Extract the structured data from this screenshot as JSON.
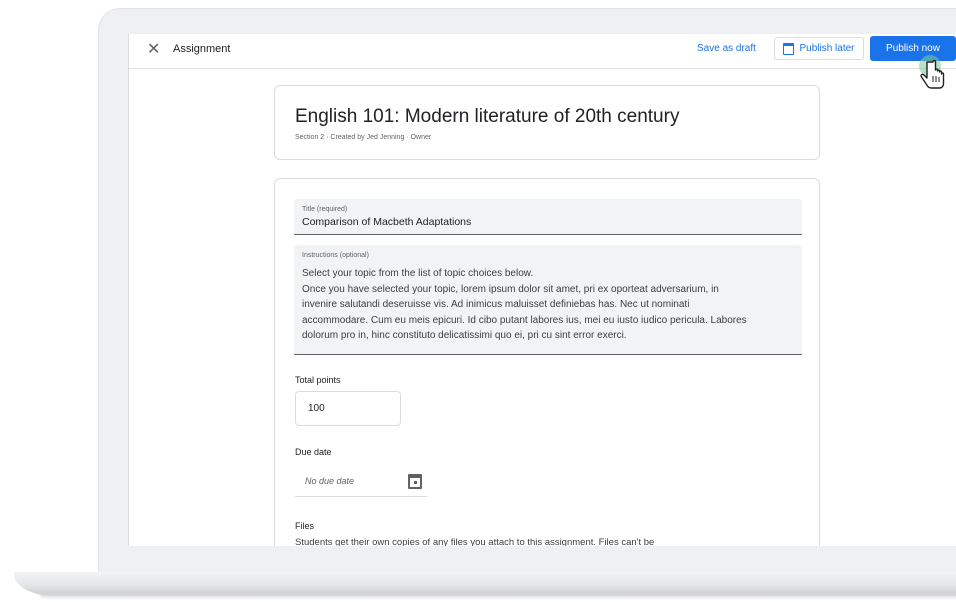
{
  "topbar": {
    "title": "Assignment",
    "close_icon": "close-icon",
    "save_draft_label": "Save as draft",
    "publish_later_label": "Publish later",
    "publish_now_label": "Publish now"
  },
  "course": {
    "title": "English 101: Modern literature of 20th century",
    "meta": "Section 2  ·  Created by Jed Jenning  ·  Owner"
  },
  "form": {
    "title_label": "Title (required)",
    "title_value": "Comparison of Macbeth Adaptations",
    "instructions_label": "Instructions (optional)",
    "instructions_lines": [
      "Select your topic from the list of topic choices below.",
      "Once you have selected your topic, lorem ipsum dolor sit amet, pri ex oporteat adversarium, in",
      "invenire salutandi deseruisse vis. Ad inimicus maluisset definiebas has. Nec ut nominati",
      "accommodare. Cum eu meis epicuri. Id cibo putant labores ius, mei eu iusto iudico pericula. Labores",
      "dolorum pro in, hinc constituto delicatissimi quo ei, pri cu sint error exerci."
    ],
    "points_label": "Total points",
    "points_value": "100",
    "due_label": "Due date",
    "due_placeholder": "No due date",
    "files_label": "Files",
    "files_note": "Students get their own copies of any files you attach to this assignment. Files can't be"
  },
  "colors": {
    "accent": "#1a73e8",
    "field_bg": "#f1f3f4",
    "border": "#dadce0"
  }
}
